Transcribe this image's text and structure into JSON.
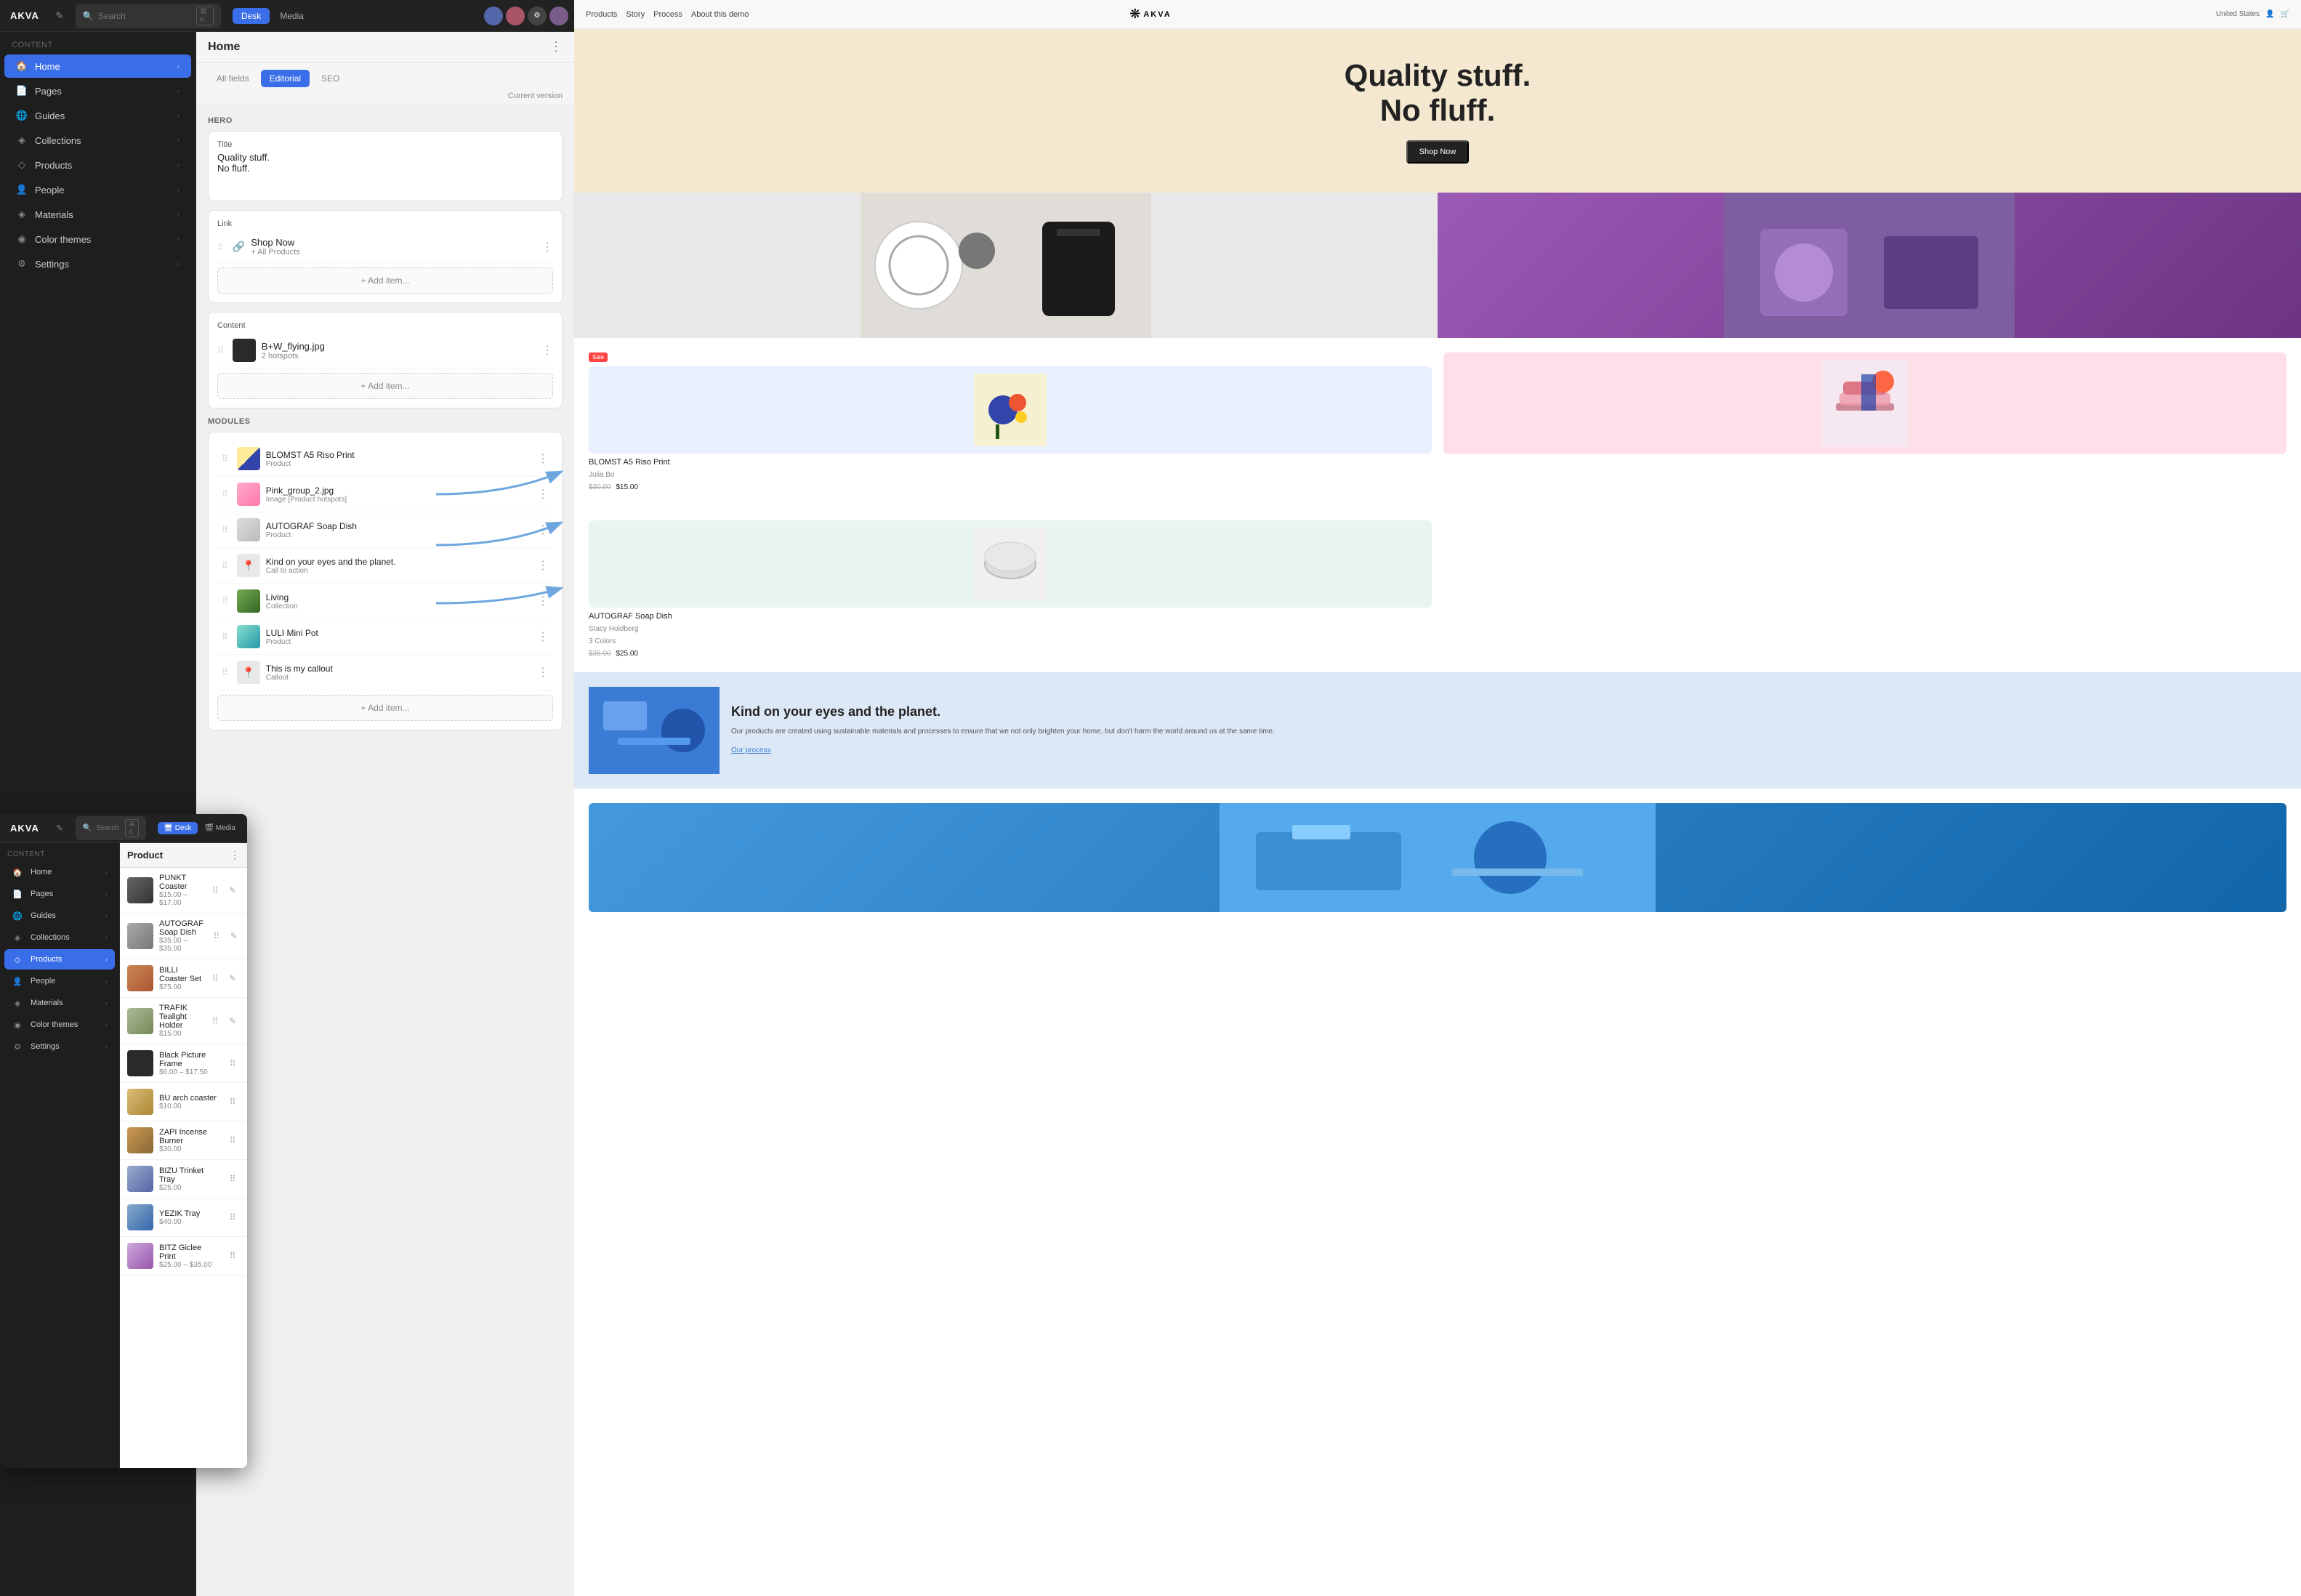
{
  "app": {
    "brand": "AKVA",
    "shortcut": "⌘ K"
  },
  "topbar": {
    "search_placeholder": "Search",
    "tab_desk": "Desk",
    "tab_media": "Media"
  },
  "sidebar": {
    "section_title": "Content",
    "items": [
      {
        "id": "home",
        "label": "Home",
        "icon": "🏠",
        "active": true
      },
      {
        "id": "pages",
        "label": "Pages",
        "icon": "📄",
        "active": false
      },
      {
        "id": "guides",
        "label": "Guides",
        "icon": "🌐",
        "active": false
      },
      {
        "id": "collections",
        "label": "Collections",
        "icon": "◈",
        "active": false
      },
      {
        "id": "products",
        "label": "Products",
        "icon": "◇",
        "active": false
      },
      {
        "id": "people",
        "label": "People",
        "icon": "👤",
        "active": false
      },
      {
        "id": "materials",
        "label": "Materials",
        "icon": "◈",
        "active": false
      },
      {
        "id": "color-themes",
        "label": "Color themes",
        "icon": "◉",
        "active": false
      },
      {
        "id": "settings",
        "label": "Settings",
        "icon": "⚙",
        "active": false
      }
    ]
  },
  "main": {
    "title": "Home",
    "version_label": "Current version",
    "tabs": [
      {
        "id": "all-fields",
        "label": "All fields",
        "active": false
      },
      {
        "id": "editorial",
        "label": "Editorial",
        "active": true
      },
      {
        "id": "seo",
        "label": "SEO",
        "active": false
      }
    ],
    "sections": {
      "hero": {
        "label": "Hero",
        "title_field_label": "Title",
        "title_value": "Quality stuff.\nNo fluff.",
        "link_label": "Link",
        "content_label": "Content"
      },
      "modules_label": "Modules"
    },
    "link_items": [
      {
        "title": "Shop Now",
        "sub": "+ All Products",
        "icon": "🔗"
      }
    ],
    "content_items": [
      {
        "title": "B+W_flying.jpg",
        "sub": "2 hotspots",
        "thumb_class": "thumb-black"
      }
    ],
    "modules": [
      {
        "title": "BLOMST A5 Riso Print",
        "type": "Product",
        "thumb_class": "thumb-blomst"
      },
      {
        "title": "Pink_group_2.jpg",
        "type": "Image [Product hotspots]",
        "thumb_class": "thumb-pink"
      },
      {
        "title": "AUTOGRAF Soap Dish",
        "type": "Product",
        "thumb_class": "thumb-soap"
      },
      {
        "title": "Kind on your eyes and the planet.",
        "type": "Call to action",
        "thumb_class": "",
        "icon": "📍"
      },
      {
        "title": "Living",
        "type": "Collection",
        "thumb_class": "thumb-living"
      },
      {
        "title": "LULI Mini Pot",
        "type": "Product",
        "thumb_class": "thumb-luli"
      },
      {
        "title": "This is my callout",
        "type": "Callout",
        "thumb_class": "",
        "icon": "📍"
      }
    ],
    "add_item_label": "+ Add item..."
  },
  "panel2": {
    "brand": "AKVA",
    "search_placeholder": "Search",
    "shortcut": "⌘ K",
    "tab_desk": "Desk",
    "tab_media": "Media",
    "sidebar_section": "Content",
    "sidebar_items": [
      {
        "id": "home2",
        "label": "Home",
        "icon": "🏠",
        "active": false
      },
      {
        "id": "pages2",
        "label": "Pages",
        "icon": "📄",
        "active": false
      },
      {
        "id": "guides2",
        "label": "Guides",
        "icon": "🌐",
        "active": false
      },
      {
        "id": "collections2",
        "label": "Collections",
        "icon": "◈",
        "active": false
      },
      {
        "id": "products2",
        "label": "Products",
        "icon": "◇",
        "active": true
      },
      {
        "id": "people2",
        "label": "People",
        "icon": "👤",
        "active": false
      },
      {
        "id": "materials2",
        "label": "Materials",
        "icon": "◈",
        "active": false
      },
      {
        "id": "color-themes2",
        "label": "Color themes",
        "icon": "◉",
        "active": false
      },
      {
        "id": "settings2",
        "label": "Settings",
        "icon": "⚙",
        "active": false
      }
    ],
    "product_section_title": "Product",
    "products": [
      {
        "name": "PUNKT Coaster",
        "price": "$15.00 – $17.00",
        "thumb_class": "thumb-punkt"
      },
      {
        "name": "AUTOGRAF Soap Dish",
        "price": "$35.00 – $35.00",
        "thumb_class": "thumb-autograf"
      },
      {
        "name": "BILLI Coaster Set",
        "price": "$75.00",
        "thumb_class": "thumb-billi"
      },
      {
        "name": "TRAFIK Tealight Holder",
        "price": "$15.00",
        "thumb_class": "thumb-trafik"
      },
      {
        "name": "Black Picture Frame",
        "price": "$6.00 – $17.50",
        "thumb_class": "thumb-black"
      },
      {
        "name": "BU arch coaster",
        "price": "$10.00",
        "thumb_class": "thumb-bu"
      },
      {
        "name": "ZAPI Incense Burner",
        "price": "$30.00",
        "thumb_class": "thumb-zapi"
      },
      {
        "name": "BIZU Trinket Tray",
        "price": "$25.00",
        "thumb_class": "thumb-bizu"
      },
      {
        "name": "YEZIK Tray",
        "price": "$40.00",
        "thumb_class": "thumb-yezik"
      },
      {
        "name": "BITZ Giclee Print",
        "price": "$25.00 – $35.00",
        "thumb_class": "thumb-bitz"
      }
    ]
  },
  "preview": {
    "nav_links": [
      "Products",
      "Story",
      "Process",
      "About this demo"
    ],
    "brand": "AKVA",
    "region": "United States",
    "hero_title": "Quality stuff.\nNo fluff.",
    "hero_btn": "Shop Now",
    "blomst_name": "BLOMST A5 Riso Print",
    "blomst_sub": "Julia Bo",
    "blomst_price_old": "$30.00",
    "blomst_price": "$15.00",
    "autograf_name": "AUTOGRAF Soap Dish",
    "autograf_sub": "Stacy Holdberg",
    "autograf_colors": "3 Colors",
    "autograf_price_old": "$35.00",
    "autograf_price": "$25.00",
    "cta_title": "Kind on your eyes and the planet.",
    "cta_desc": "Our products are created using sustainable materials and processes to ensure that we not only brighten your home, but don't harm the world around us at the same time.",
    "cta_link": "Our process"
  }
}
